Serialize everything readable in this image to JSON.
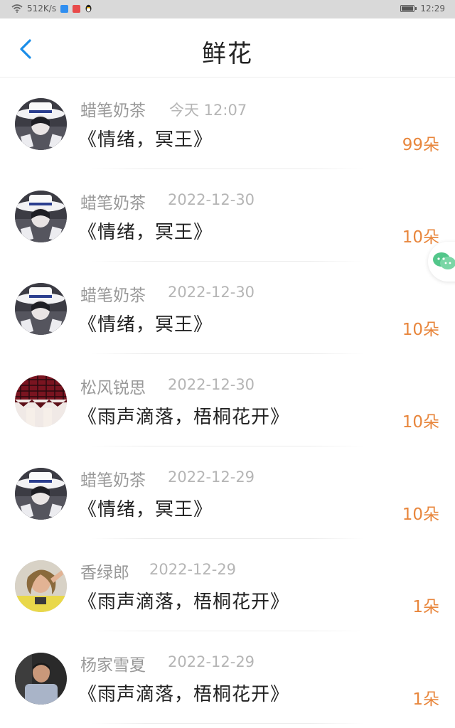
{
  "status_bar": {
    "net_speed": "512K/s",
    "time": "12:29",
    "battery_level": 0.85
  },
  "header": {
    "title": "鲜花"
  },
  "colors": {
    "accent_blue": "#1a8de8",
    "count_orange": "#e8863c"
  },
  "flowers": [
    {
      "user": "蜡笔奶茶",
      "date": "今天 12:07",
      "work": "《情绪，冥王》",
      "count": "99朵",
      "avatar": "white-hat-anime"
    },
    {
      "user": "蜡笔奶茶",
      "date": "2022-12-30",
      "work": "《情绪，冥王》",
      "count": "10朵",
      "avatar": "white-hat-anime"
    },
    {
      "user": "蜡笔奶茶",
      "date": "2022-12-30",
      "work": "《情绪，冥王》",
      "count": "10朵",
      "avatar": "white-hat-anime"
    },
    {
      "user": "松风锐思",
      "date": "2022-12-30",
      "work": "《雨声滴落，梧桐花开》",
      "count": "10朵",
      "avatar": "red-plaid"
    },
    {
      "user": "蜡笔奶茶",
      "date": "2022-12-29",
      "work": "《情绪，冥王》",
      "count": "10朵",
      "avatar": "white-hat-anime"
    },
    {
      "user": "香绿郎",
      "date": "2022-12-29",
      "work": "《雨声滴落，梧桐花开》",
      "count": "1朵",
      "avatar": "woman-photo"
    },
    {
      "user": "杨家雪夏",
      "date": "2022-12-29",
      "work": "《雨声滴落，梧桐花开》",
      "count": "1朵",
      "avatar": "man-photo"
    }
  ]
}
